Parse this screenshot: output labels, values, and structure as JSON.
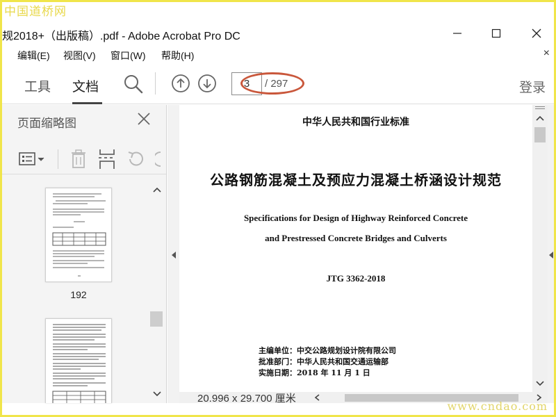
{
  "watermark": {
    "top": "中国道桥网",
    "bottom": "www.cndao.com"
  },
  "window": {
    "title": "规2018+（出版稿）.pdf - Adobe Acrobat Pro DC",
    "minimize_icon": "minimize-icon",
    "maximize_icon": "maximize-icon",
    "close_icon": "close-icon"
  },
  "menu": {
    "items": [
      "编辑(E)",
      "视图(V)",
      "窗口(W)",
      "帮助(H)"
    ],
    "close_glyph": "×"
  },
  "toolbar": {
    "tab_tools": "工具",
    "tab_document": "文档",
    "search_icon": "search-icon",
    "prev_icon": "arrow-up-circle-icon",
    "next_icon": "arrow-down-circle-icon",
    "page_current": "3",
    "page_total": "/ 297",
    "login": "登录",
    "highlight_color": "#c9573b"
  },
  "side_panel": {
    "title": "页面缩略图",
    "tools": [
      "thumbnail-options-icon",
      "delete-page-icon",
      "insert-page-icon",
      "undo-icon"
    ],
    "thumbnails": [
      {
        "label": "192"
      },
      {
        "label": ""
      }
    ]
  },
  "document": {
    "line1": "中华人民共和国行业标准",
    "title": "公路钢筋混凝土及预应力混凝土桥涵设计规范",
    "english1": "Specifications for Design of Highway Reinforced Concrete",
    "english2": "and Prestressed Concrete Bridges and Culverts",
    "code": "JTG 3362-2018",
    "editor": "主编单位：中交公路规划设计院有限公司",
    "approver": "批准部门：中华人民共和国交通运输部",
    "effective": "实施日期：2018 年 11 月 1 日"
  },
  "status": {
    "page_size": "20.996 x 29.700 厘米"
  },
  "colors": {
    "frame": "#f0e54a",
    "watermark": "#e8d84a",
    "panel_bg": "#f4f4f4"
  }
}
